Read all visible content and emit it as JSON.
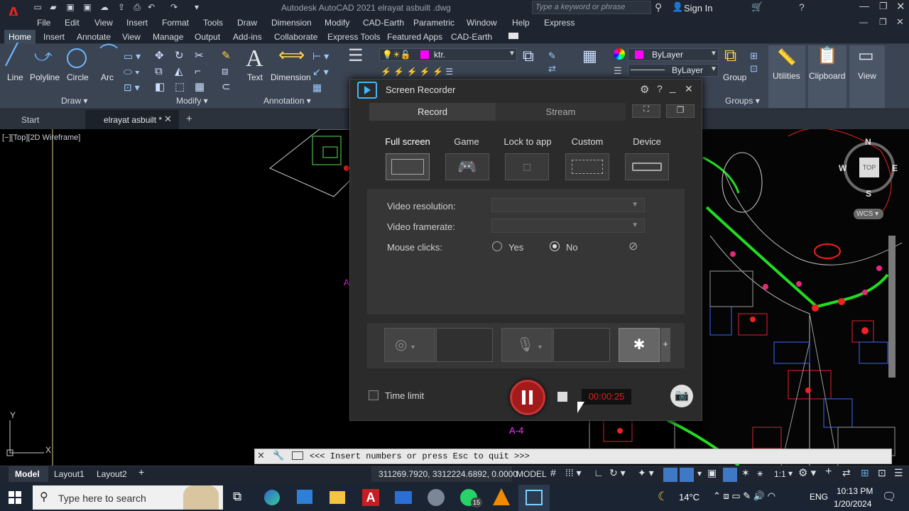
{
  "app": {
    "title": "Autodesk AutoCAD 2021   elrayat asbuilt .dwg",
    "logo": "A",
    "search_placeholder": "Type a keyword or phrase",
    "sign_in": "Sign In"
  },
  "menu": [
    "File",
    "Edit",
    "View",
    "Insert",
    "Format",
    "Tools",
    "Draw",
    "Dimension",
    "Modify",
    "CAD-Earth",
    "Parametric",
    "Window",
    "Help",
    "Express"
  ],
  "ribbon_tabs": [
    "Home",
    "Insert",
    "Annotate",
    "View",
    "Manage",
    "Output",
    "Add-ins",
    "Collaborate",
    "Express Tools",
    "Featured Apps",
    "CAD-Earth"
  ],
  "ribbon": {
    "draw_tools": [
      "Line",
      "Polyline",
      "Circle",
      "Arc"
    ],
    "text": "Text",
    "dimension": "Dimension",
    "layer_value": "ktr.",
    "bylayer1": "ByLayer",
    "bylayer2": "ByLayer",
    "group": "Group",
    "utilities": "Utilities",
    "clipboard": "Clipboard",
    "view": "View",
    "panels": {
      "draw": "Draw",
      "modify": "Modify",
      "annotation": "Annotation",
      "groups": "Groups"
    }
  },
  "file_tabs": {
    "start": "Start",
    "current": "elrayat asbuilt *"
  },
  "viewport": {
    "label": "[−][Top][2D Wireframe]",
    "viewcube": {
      "n": "N",
      "s": "S",
      "e": "E",
      "w": "W",
      "top": "TOP",
      "wcs": "WCS"
    },
    "annotation": "A-4",
    "command_prompt": "<<< Insert numbers or press Esc to quit >>>"
  },
  "layout_tabs": [
    "Model",
    "Layout1",
    "Layout2"
  ],
  "status": {
    "coords": "311269.7920, 3312224.6892, 0.0000",
    "model": "MODEL",
    "scale": "1:1"
  },
  "recorder": {
    "title": "Screen Recorder",
    "tabs": {
      "record": "Record",
      "stream": "Stream"
    },
    "modes": [
      "Full screen",
      "Game",
      "Lock to app",
      "Custom",
      "Device"
    ],
    "settings": {
      "resolution_label": "Video resolution:",
      "framerate_label": "Video framerate:",
      "mouse_label": "Mouse clicks:",
      "yes": "Yes",
      "no": "No"
    },
    "time_limit": "Time limit",
    "timer": "00:00:25"
  },
  "taskbar": {
    "search": "Type here to search",
    "weather": "14°C",
    "lang": "ENG",
    "time": "10:13 PM",
    "date": "1/20/2024",
    "whatsapp_badge": "15"
  },
  "colors": {
    "accent": "#a31a1a",
    "timer": "#e01e1e",
    "magenta": "#ff00ff",
    "ribbon": "#3b4453"
  }
}
